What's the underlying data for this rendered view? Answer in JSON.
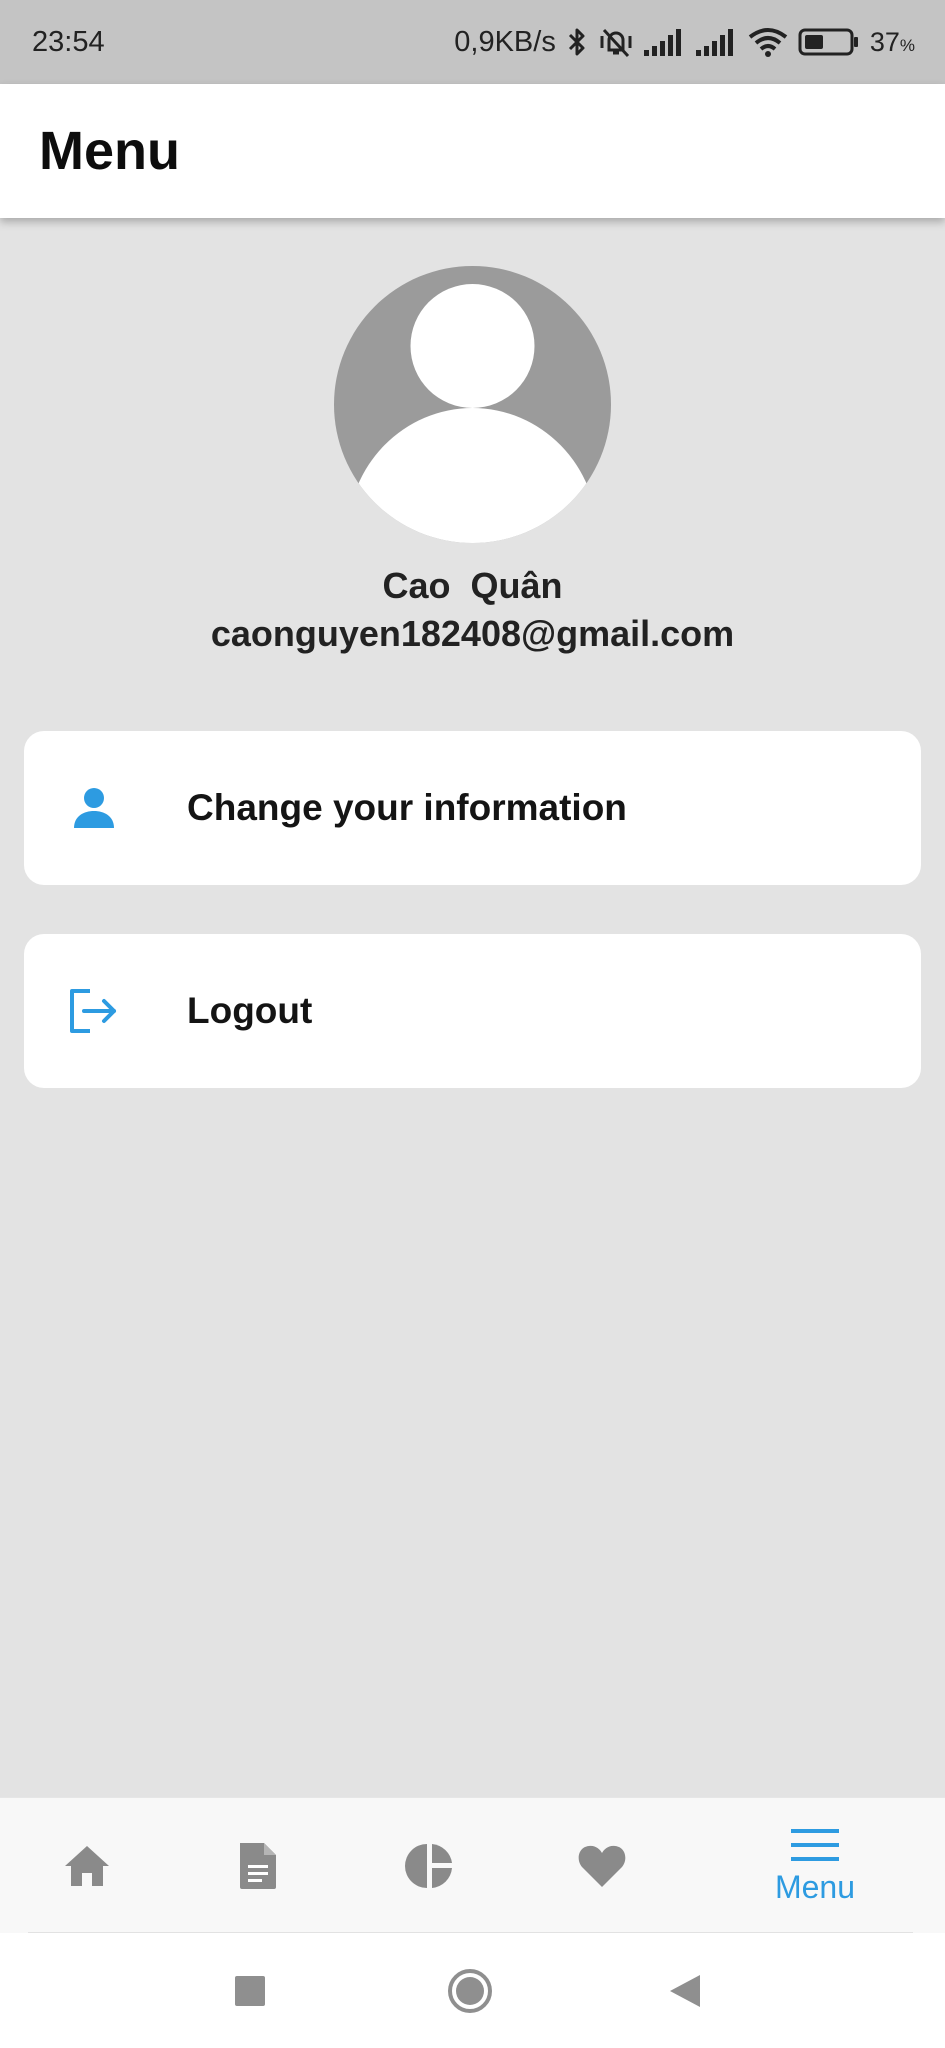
{
  "status_bar": {
    "time": "23:54",
    "network_speed": "0,9KB/s",
    "battery_percent": "37",
    "battery_symbol": "%",
    "icons": [
      "bluetooth-icon",
      "mute-vibrate-icon",
      "signal-icon",
      "signal-icon",
      "wifi-icon",
      "battery-icon"
    ]
  },
  "header": {
    "title": "Menu"
  },
  "profile": {
    "name": "Cao  Quân",
    "email": "caonguyen182408@gmail.com",
    "avatar_icon": "default-avatar-icon"
  },
  "menu": {
    "items": [
      {
        "label": "Change your information",
        "icon": "person-icon"
      },
      {
        "label": "Logout",
        "icon": "logout-icon"
      }
    ]
  },
  "bottom_nav": {
    "items": [
      {
        "icon": "home-icon",
        "label": ""
      },
      {
        "icon": "document-icon",
        "label": ""
      },
      {
        "icon": "pie-chart-icon",
        "label": ""
      },
      {
        "icon": "heart-icon",
        "label": ""
      },
      {
        "icon": "menu-icon",
        "label": "Menu"
      }
    ],
    "active_index": 4
  },
  "system_nav": {
    "icons": [
      "recents-square-icon",
      "home-circle-icon",
      "back-triangle-icon"
    ]
  },
  "colors": {
    "accent": "#2d9be1",
    "background": "#e3e3e3",
    "card": "#ffffff",
    "nav_inactive": "#8a8a8a",
    "avatar_bg": "#9b9b9b"
  }
}
